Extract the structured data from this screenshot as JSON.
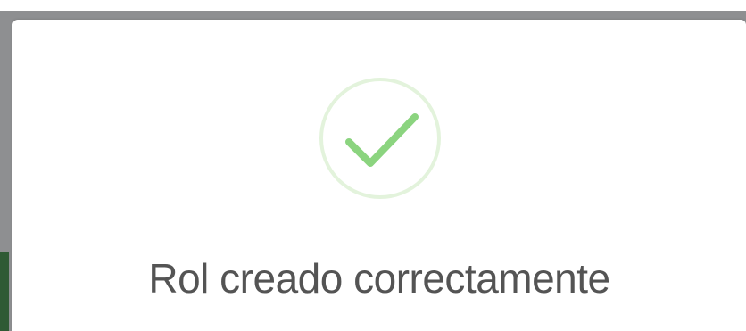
{
  "dialog": {
    "message": "Rol creado correctamente",
    "icon": "success-check-icon"
  },
  "colors": {
    "icon_ring": "#e3f3dc",
    "icon_check": "#8bd47f",
    "message_text": "#545454",
    "overlay": "#8e8f91",
    "accent": "#2f5a34"
  }
}
